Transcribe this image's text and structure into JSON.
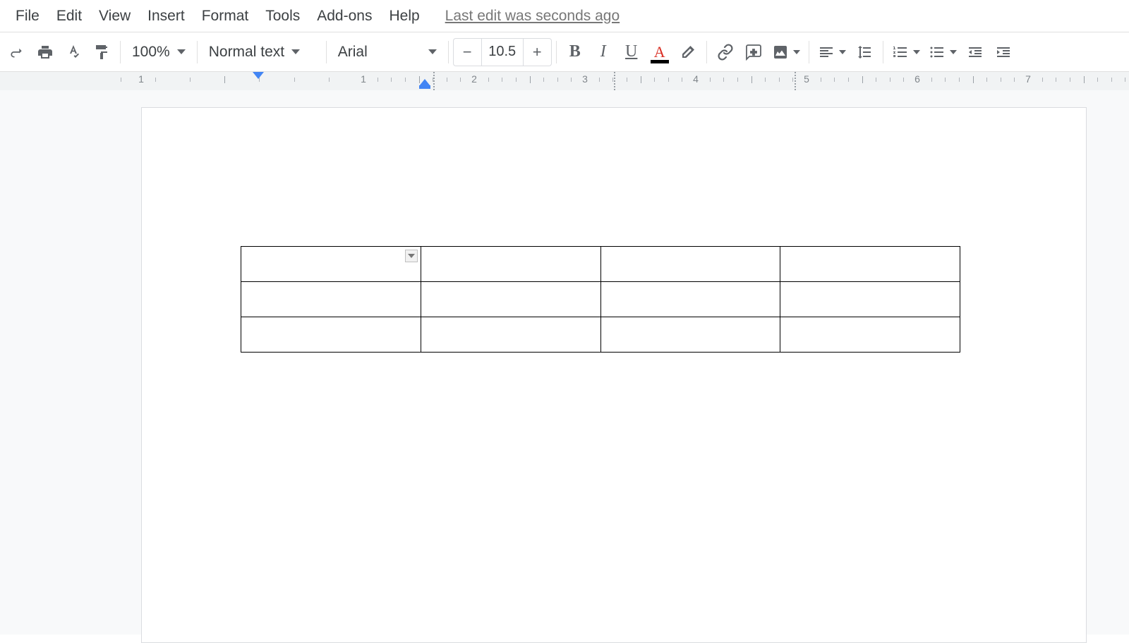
{
  "menu": {
    "items": [
      "File",
      "Edit",
      "View",
      "Insert",
      "Format",
      "Tools",
      "Add-ons",
      "Help"
    ],
    "edit_info": "Last edit was seconds ago"
  },
  "toolbar": {
    "zoom": "100%",
    "style": "Normal text",
    "font": "Arial",
    "font_size": "10.5"
  },
  "ruler": {
    "numbers": [
      1,
      1,
      2,
      3,
      4,
      5,
      6,
      7
    ]
  },
  "table": {
    "rows": 3,
    "cols": 4
  }
}
